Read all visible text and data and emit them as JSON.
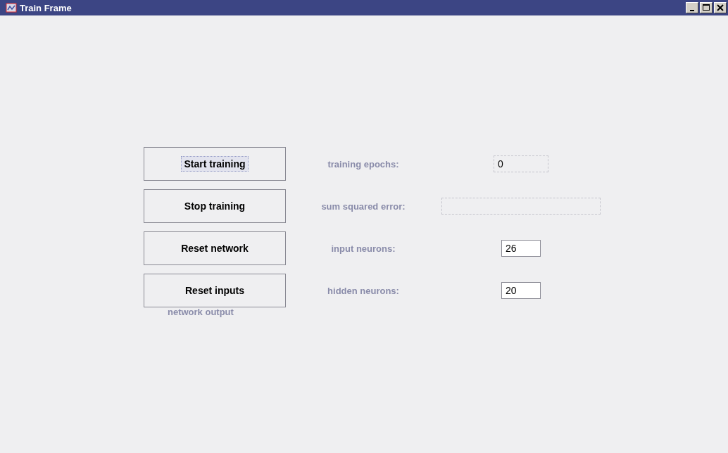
{
  "window": {
    "title": "Train Frame"
  },
  "rows": [
    {
      "button": "Start training",
      "focused": true,
      "label": "training epochs:",
      "field": {
        "kind": "short",
        "value": "0",
        "disabled": true
      }
    },
    {
      "button": "Stop training",
      "focused": false,
      "label": "sum squared error:",
      "field": {
        "kind": "wide",
        "disabled": true
      }
    },
    {
      "button": "Reset network",
      "focused": false,
      "label": "input neurons:",
      "field": {
        "kind": "short",
        "value": "26",
        "disabled": false
      }
    },
    {
      "button": "Reset inputs",
      "focused": false,
      "label": "hidden neurons:",
      "field": {
        "kind": "short",
        "value": "20",
        "disabled": false
      }
    }
  ],
  "output_label": "network output"
}
